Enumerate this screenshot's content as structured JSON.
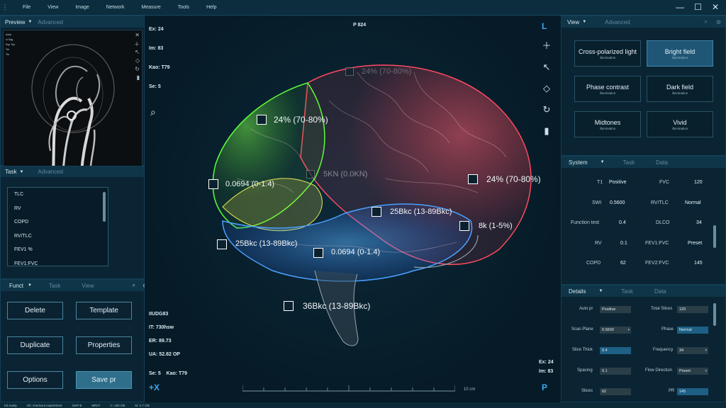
{
  "menu": [
    "File",
    "View",
    "Image",
    "Network",
    "Measure",
    "Tools",
    "Help"
  ],
  "window": {
    "min": "—",
    "max": "☐",
    "close": "✕"
  },
  "preview": {
    "tab": "Preview",
    "tab2": "Advanced",
    "labels": [
      "Axial",
      "Lt  Sag",
      "Sup Thp",
      "Trk",
      "Tlo"
    ],
    "foot_left": "+X",
    "foot_right": "P"
  },
  "task": {
    "tab": "Task",
    "tab2": "Advanced",
    "items": [
      "TLC",
      "RV",
      "COPD",
      "RV/TLC",
      "FEV1 %",
      "FEV1:FVC"
    ]
  },
  "funct": {
    "tab": "Funct",
    "tab2": "Task",
    "tab3": "View"
  },
  "buttons": {
    "delete": "Delete",
    "template": "Template",
    "duplicate": "Duplicate",
    "properties": "Properties",
    "options": "Options",
    "save": "Save pr"
  },
  "viewer": {
    "tl": [
      "Ex: 24",
      "Im: 83",
      "Kao: T79",
      "Se: 5"
    ],
    "top": "P 824",
    "bl": [
      "IIUDG83",
      "IT: 730hsw",
      "ER: 89.73",
      "UA: 52.82 OP"
    ],
    "bl2": "Se: 5    Kao: T79",
    "br": [
      "Ex: 24",
      "Im: 83"
    ],
    "plusx": "+X",
    "p": "P",
    "L": "L",
    "scale": "10 cm",
    "annotations": [
      "24% (70-80%)",
      "0.0694 (0-1.4)",
      "5KN (0.0KN)",
      "24% (70-80%)",
      "25Bkc (13-89Bkc)",
      "8k (1-5%)",
      "25Bkc (13-89Bkc)",
      "0.0694 (0-1.4)",
      "36Bkc (13-89Bkc)",
      "24% (70-80%)"
    ]
  },
  "view": {
    "tab": "View",
    "tab2": "Advanced",
    "tiles": [
      {
        "t": "Cross-polarized light",
        "s": "illumination"
      },
      {
        "t": "Bright field",
        "s": "illumination"
      },
      {
        "t": "Phase contrast",
        "s": "illumination"
      },
      {
        "t": "Dark field",
        "s": "illumination"
      },
      {
        "t": "Midtones",
        "s": "illumination"
      },
      {
        "t": "Vivid",
        "s": "illumination"
      }
    ]
  },
  "system": {
    "tab": "System",
    "tab2": "Task",
    "tab3": "Data",
    "rows": [
      [
        "T1",
        "Positive",
        "FVC",
        "120"
      ],
      [
        "SWI",
        "0.5600",
        "RV/TLC",
        "Normal"
      ],
      [
        "Function test",
        "0.4",
        "DLCO",
        "34"
      ],
      [
        "RV",
        "0.1",
        "FEV1:FVC",
        "Preset"
      ],
      [
        "COPD",
        "62",
        "FEV2:FVC",
        "145"
      ]
    ]
  },
  "details": {
    "tab": "Details",
    "tab2": "Task",
    "tab3": "Data",
    "rows": [
      [
        "Auto pr",
        "Positive",
        "Total Slices",
        "120"
      ],
      [
        "Scan Plane",
        "0.5600",
        "Phase",
        "Normal"
      ],
      [
        "Slice Thick",
        "0.4",
        "Frequency",
        "34"
      ],
      [
        "Spacing",
        "0.1",
        "Flow Direction",
        "Preset"
      ],
      [
        "Slices",
        "62",
        "PR",
        "145"
      ]
    ]
  },
  "status": [
    "Kit ready",
    "Git: checkout experiment",
    "GMT-8",
    "MR07",
    "C: 180 GB",
    "M: 2.7 GB"
  ]
}
